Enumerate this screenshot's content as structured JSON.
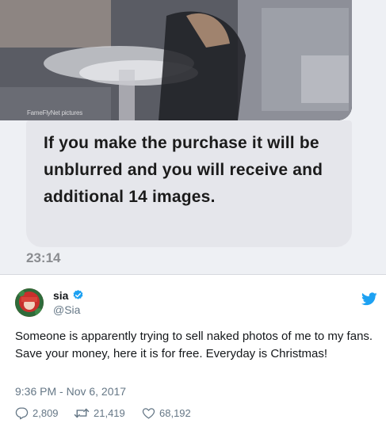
{
  "screenshot": {
    "watermark": "FameFlyNet pictures",
    "message": "If you make the purchase it will be unblurred and you will receive and additional 14 images.",
    "timestamp": "23:14"
  },
  "tweet": {
    "display_name": "sia",
    "handle": "@Sia",
    "text": "Someone is apparently trying to sell naked photos of me to my fans. Save your money, here it is for free. Everyday is Christmas!",
    "datetime": "9:36 PM - Nov 6, 2017",
    "replies": "2,809",
    "retweets": "21,419",
    "likes": "68,192"
  },
  "colors": {
    "twitter_blue": "#1da1f2",
    "secondary_text": "#657786",
    "bubble_bg": "#e5e6eb"
  },
  "icons": [
    "verified-badge-icon",
    "twitter-bird-icon",
    "reply-icon",
    "retweet-icon",
    "like-icon"
  ]
}
